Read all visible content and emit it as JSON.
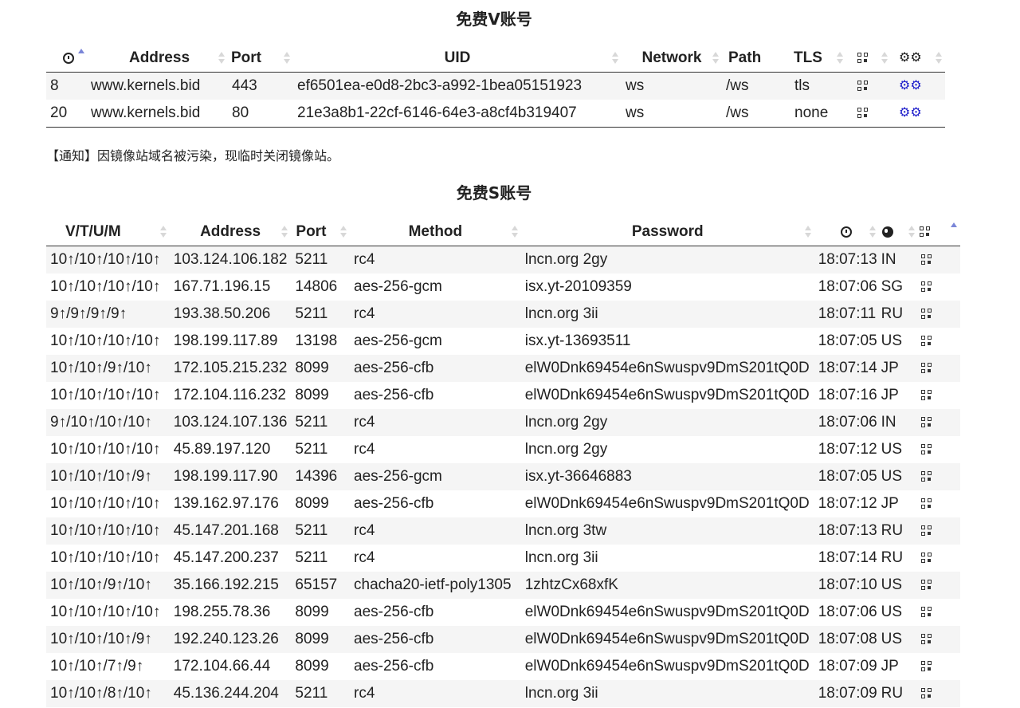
{
  "v_section": {
    "title": "免费V账号",
    "headers": [
      "Address",
      "Port",
      "UID",
      "Network",
      "Path",
      "TLS"
    ],
    "rows": [
      {
        "count": "8",
        "address": "www.kernels.bid",
        "port": "443",
        "uid": "ef6501ea-e0d8-2bc3-a992-1bea05151923",
        "network": "ws",
        "path": "/ws",
        "tls": "tls"
      },
      {
        "count": "20",
        "address": "www.kernels.bid",
        "port": "80",
        "uid": "21e3a8b1-22cf-6146-64e3-a8cf4b319407",
        "network": "ws",
        "path": "/ws",
        "tls": "none"
      }
    ]
  },
  "notice": "【通知】因镜像站域名被污染，现临时关闭镜像站。",
  "s_section": {
    "title": "免费S账号",
    "headers": [
      "V/T/U/M",
      "Address",
      "Port",
      "Method",
      "Password"
    ],
    "rows": [
      {
        "vtum": "10↑/10↑/10↑/10↑",
        "address": "103.124.106.182",
        "port": "5211",
        "method": "rc4",
        "password": "lncn.org 2gy",
        "time": "18:07:13",
        "country": "IN"
      },
      {
        "vtum": "10↑/10↑/10↑/10↑",
        "address": "167.71.196.15",
        "port": "14806",
        "method": "aes-256-gcm",
        "password": "isx.yt-20109359",
        "time": "18:07:06",
        "country": "SG"
      },
      {
        "vtum": "9↑/9↑/9↑/9↑",
        "address": "193.38.50.206",
        "port": "5211",
        "method": "rc4",
        "password": "lncn.org 3ii",
        "time": "18:07:11",
        "country": "RU"
      },
      {
        "vtum": "10↑/10↑/10↑/10↑",
        "address": "198.199.117.89",
        "port": "13198",
        "method": "aes-256-gcm",
        "password": "isx.yt-13693511",
        "time": "18:07:05",
        "country": "US"
      },
      {
        "vtum": "10↑/10↑/9↑/10↑",
        "address": "172.105.215.232",
        "port": "8099",
        "method": "aes-256-cfb",
        "password": "elW0Dnk69454e6nSwuspv9DmS201tQ0D",
        "time": "18:07:14",
        "country": "JP"
      },
      {
        "vtum": "10↑/10↑/10↑/10↑",
        "address": "172.104.116.232",
        "port": "8099",
        "method": "aes-256-cfb",
        "password": "elW0Dnk69454e6nSwuspv9DmS201tQ0D",
        "time": "18:07:16",
        "country": "JP"
      },
      {
        "vtum": "9↑/10↑/10↑/10↑",
        "address": "103.124.107.136",
        "port": "5211",
        "method": "rc4",
        "password": "lncn.org 2gy",
        "time": "18:07:06",
        "country": "IN"
      },
      {
        "vtum": "10↑/10↑/10↑/10↑",
        "address": "45.89.197.120",
        "port": "5211",
        "method": "rc4",
        "password": "lncn.org 2gy",
        "time": "18:07:12",
        "country": "US"
      },
      {
        "vtum": "10↑/10↑/10↑/9↑",
        "address": "198.199.117.90",
        "port": "14396",
        "method": "aes-256-gcm",
        "password": "isx.yt-36646883",
        "time": "18:07:05",
        "country": "US"
      },
      {
        "vtum": "10↑/10↑/10↑/10↑",
        "address": "139.162.97.176",
        "port": "8099",
        "method": "aes-256-cfb",
        "password": "elW0Dnk69454e6nSwuspv9DmS201tQ0D",
        "time": "18:07:12",
        "country": "JP"
      },
      {
        "vtum": "10↑/10↑/10↑/10↑",
        "address": "45.147.201.168",
        "port": "5211",
        "method": "rc4",
        "password": "lncn.org 3tw",
        "time": "18:07:13",
        "country": "RU"
      },
      {
        "vtum": "10↑/10↑/10↑/10↑",
        "address": "45.147.200.237",
        "port": "5211",
        "method": "rc4",
        "password": "lncn.org 3ii",
        "time": "18:07:14",
        "country": "RU"
      },
      {
        "vtum": "10↑/10↑/9↑/10↑",
        "address": "35.166.192.215",
        "port": "65157",
        "method": "chacha20-ietf-poly1305",
        "password": "1zhtzCx68xfK",
        "time": "18:07:10",
        "country": "US"
      },
      {
        "vtum": "10↑/10↑/10↑/10↑",
        "address": "198.255.78.36",
        "port": "8099",
        "method": "aes-256-cfb",
        "password": "elW0Dnk69454e6nSwuspv9DmS201tQ0D",
        "time": "18:07:06",
        "country": "US"
      },
      {
        "vtum": "10↑/10↑/10↑/9↑",
        "address": "192.240.123.26",
        "port": "8099",
        "method": "aes-256-cfb",
        "password": "elW0Dnk69454e6nSwuspv9DmS201tQ0D",
        "time": "18:07:08",
        "country": "US"
      },
      {
        "vtum": "10↑/10↑/7↑/9↑",
        "address": "172.104.66.44",
        "port": "8099",
        "method": "aes-256-cfb",
        "password": "elW0Dnk69454e6nSwuspv9DmS201tQ0D",
        "time": "18:07:09",
        "country": "JP"
      },
      {
        "vtum": "10↑/10↑/8↑/10↑",
        "address": "45.136.244.204",
        "port": "5211",
        "method": "rc4",
        "password": "lncn.org 3ii",
        "time": "18:07:09",
        "country": "RU"
      }
    ]
  },
  "icons": {
    "clock": "clock-icon",
    "globe": "globe-icon",
    "qrcode": "qrcode-icon",
    "gears": "gears-icon"
  },
  "colors": {
    "sort_active": "#7a86d8",
    "gear_link": "#2222cc",
    "row_stripe": "#f5f5f5"
  }
}
